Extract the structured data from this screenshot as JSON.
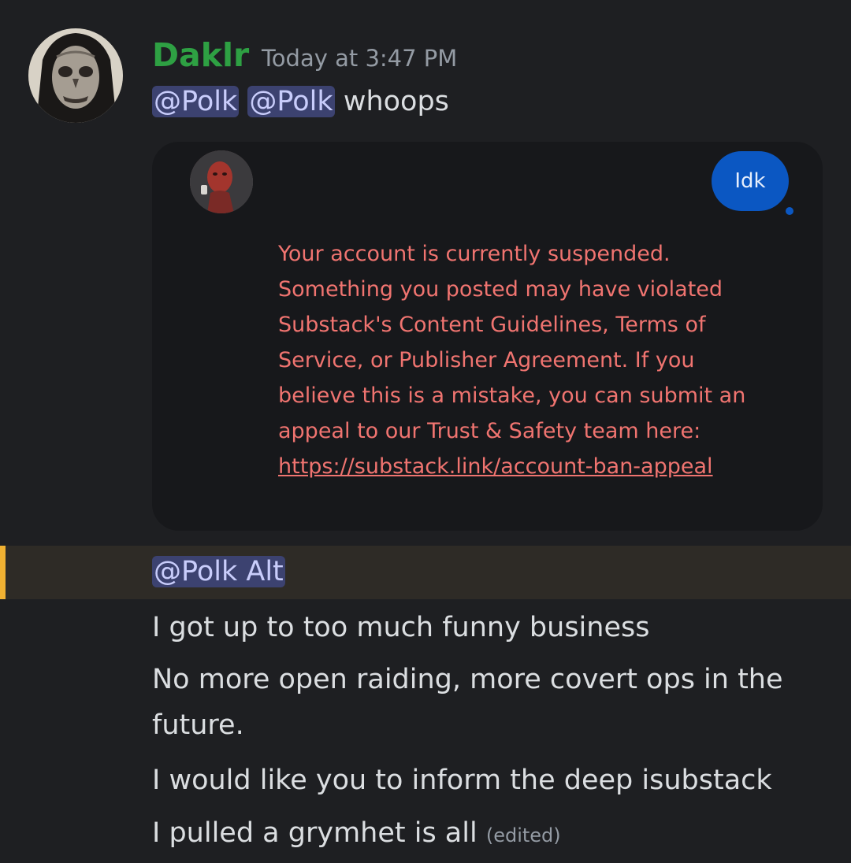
{
  "message": {
    "author": "Daklr",
    "author_color": "#2ea043",
    "timestamp": "Today at 3:47 PM",
    "mentions": [
      "@Polk",
      "@Polk"
    ],
    "text": "whoops",
    "avatar_icon": "zombie-face-avatar"
  },
  "embed": {
    "avatar_icon": "red-face-avatar",
    "reply_bubble": "Idk",
    "notice_lines": [
      "Your account is currently suspended.",
      "Something you posted may have violated",
      "Substack's Content Guidelines, Terms of",
      "Service, or Publisher Agreement. If you",
      "believe this is a mistake, you can submit an",
      "appeal to our Trust & Safety team here:"
    ],
    "link": "https://substack.link/account-ban-appeal",
    "notice_color": "#f07470"
  },
  "followup": {
    "mention": "@Polk Alt",
    "highlight_color": "#f0b132",
    "lines": [
      "I got up to too much funny business",
      "No more open raiding, more covert ops in the",
      "future.",
      "I would like you to inform the deep isubstack",
      "I pulled a grymhet is all"
    ],
    "edited_label": "(edited)"
  }
}
